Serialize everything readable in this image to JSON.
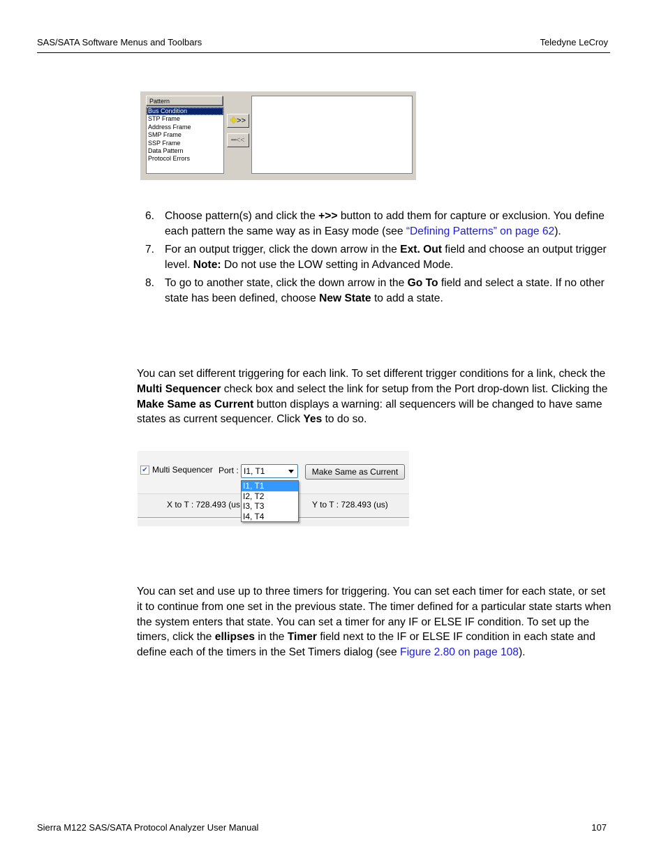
{
  "header": {
    "section_title": "SAS/SATA Software Menus and Toolbars",
    "company": "Teledyne LeCroy"
  },
  "pattern_dialog": {
    "column_header": "Pattern",
    "items": [
      {
        "label": "Bus Condition",
        "selected": true
      },
      {
        "label": "STP Frame",
        "selected": false
      },
      {
        "label": "Address Frame",
        "selected": false
      },
      {
        "label": "SMP Frame",
        "selected": false
      },
      {
        "label": "SSP Frame",
        "selected": false
      },
      {
        "label": "Data Pattern",
        "selected": false
      },
      {
        "label": "Protocol Errors",
        "selected": false
      }
    ],
    "add_button": {
      "icon": "plus-icon",
      "label": ">>"
    },
    "remove_button": {
      "icon": "minus-icon",
      "label": "<<",
      "disabled": true
    },
    "selected_patterns": []
  },
  "steps": [
    {
      "number": "6.",
      "parts": [
        {
          "t": "Choose pattern(s) and click the "
        },
        {
          "t": "+>>",
          "b": true
        },
        {
          "t": " button to add them for capture or exclusion. You define each pattern the same way as in Easy mode (see "
        },
        {
          "t": "“Defining Patterns” on page 62",
          "link": true
        },
        {
          "t": ")."
        }
      ]
    },
    {
      "number": "7.",
      "parts": [
        {
          "t": "For an output trigger, click the down arrow in the "
        },
        {
          "t": "Ext. Out",
          "b": true
        },
        {
          "t": " field and choose an output trigger level. "
        },
        {
          "t": "Note:",
          "b": true
        },
        {
          "t": " Do not use the LOW setting in Advanced Mode."
        }
      ]
    },
    {
      "number": "8.",
      "parts": [
        {
          "t": "To go to another state, click the down arrow in the "
        },
        {
          "t": "Go To",
          "b": true
        },
        {
          "t": " field and select a state. If no other state has been defined, choose "
        },
        {
          "t": "New State",
          "b": true
        },
        {
          "t": " to add a state."
        }
      ]
    }
  ],
  "multi_sequencer_paragraph": [
    {
      "t": "You can set different triggering for each link. To set different trigger conditions for a link, check the "
    },
    {
      "t": "Multi Sequencer",
      "b": true
    },
    {
      "t": " check box and select the link for setup from the Port drop-down list. Clicking the "
    },
    {
      "t": "Make Same as Current",
      "b": true
    },
    {
      "t": " button displays a warning: all sequencers will be changed to have same states as current sequencer. Click "
    },
    {
      "t": "Yes",
      "b": true
    },
    {
      "t": " to do so."
    }
  ],
  "sequencer_ui": {
    "checkbox_label": "Multi Sequencer",
    "checkbox_checked": true,
    "port_label": "Port :",
    "port_value": "I1, T1",
    "port_options": [
      "I1, T1",
      "I2, T2",
      "I3, T3",
      "I4, T4"
    ],
    "make_same_button": "Make Same as Current",
    "x_to_t": "X to T : 728.493 (us",
    "y_to_t": "Y to T : 728.493 (us)"
  },
  "timers_paragraph": [
    {
      "t": "You can set and use up to three timers for triggering. You can set each timer for each state, or set it to continue from one set in the previous state. The timer defined for a particular state starts when the system enters that state. You can set a timer for any IF or ELSE IF condition. To set up the timers, click the "
    },
    {
      "t": "ellipses",
      "b": true
    },
    {
      "t": " in the "
    },
    {
      "t": "Timer",
      "b": true
    },
    {
      "t": " field next to the IF or ELSE IF condition in each state and define each of the timers in the Set Timers dialog (see "
    },
    {
      "t": "Figure 2.80 on page 108",
      "link": true
    },
    {
      "t": ")."
    }
  ],
  "footer": {
    "manual_title": "Sierra M122 SAS/SATA Protocol Analyzer User Manual",
    "page_number": "107"
  }
}
